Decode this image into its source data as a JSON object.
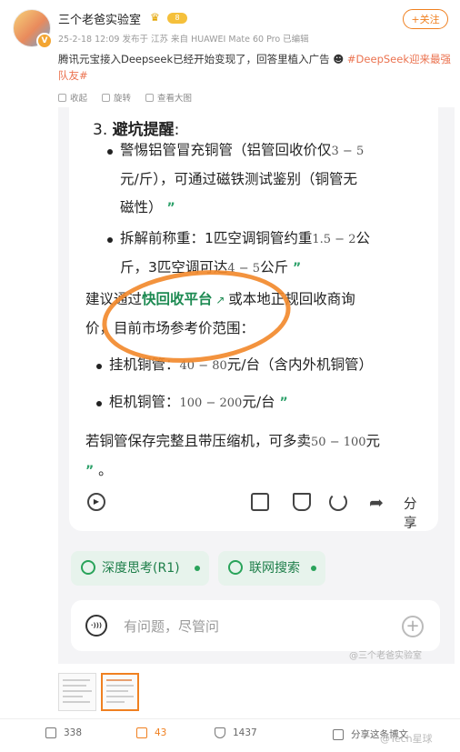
{
  "author": {
    "name": "三个老爸实验室",
    "vip_badge": "8"
  },
  "follow_label": "+关注",
  "meta": {
    "date": "25-2-18 12:09",
    "source": "发布于 江苏 来自 HUAWEI Mate 60 Pro 已编辑"
  },
  "post": {
    "text": "腾讯元宝接入Deepseek已经开始变现了，回答里植入广告",
    "hashtag": "#DeepSeek迎来最强队友#"
  },
  "toolbar": {
    "collapse": "收起",
    "rotate": "旋转",
    "view_large": "查看大图"
  },
  "answer": {
    "heading_num": "3.",
    "heading": "避坑提醒",
    "heading_colon": ":",
    "bullet1_line1a": "警惕铝管冒充铜管（铝管回收价仅",
    "bullet1_range": "3 − 5",
    "bullet1_line2": "元/斤），可通过磁铁测试鉴别（铜管无",
    "bullet1_line3": "磁性）",
    "bullet2_line1a": "拆解前称重：1匹空调铜管约重",
    "bullet2_range1": "1.5 − 2",
    "bullet2_unit": "公",
    "bullet2_line2a": "斤，3匹空调可达",
    "bullet2_range2": "4 − 5",
    "bullet2_line2b": "公斤",
    "para_line1a": "建议通过",
    "para_link": "快回收平台",
    "para_line1b": "或本地正规回收商询",
    "para_line2": "价，目前市场参考价范围：",
    "item1_label": "挂机铜管：",
    "item1_range": "40 − 80",
    "item1_unit": "元/台（含内外机铜管）",
    "item2_label": "柜机铜管：",
    "item2_range": "100 − 200",
    "item2_unit": "元/台",
    "final_line1a": "若铜管保存完整且带压缩机，可多卖",
    "final_range": "50 − 100",
    "final_unit": "元",
    "final_end": "。",
    "quote_mark": "”",
    "share_label": "分享"
  },
  "chips": {
    "deep_think": "深度思考(R1)",
    "web_search": "联网搜索"
  },
  "input": {
    "placeholder": "有问题，尽管问",
    "voice_icon": "·)))"
  },
  "watermark_inner": "@三个老爸实验室",
  "stats": {
    "reposts": "338",
    "comments": "43",
    "likes": "1437",
    "share": "分享这条博文"
  },
  "watermark_bottom": "@Tech星球",
  "colors": {
    "accent_orange": "#f08020",
    "green": "#1d8a52",
    "chip_bg": "#e7f3ec"
  },
  "icons": [
    "avatar",
    "crown-icon",
    "collapse-icon",
    "rotate-icon",
    "zoom-icon",
    "play-icon",
    "copy-icon",
    "dislike-icon",
    "refresh-icon",
    "share-icon",
    "deep-think-icon",
    "globe-icon",
    "voice-icon",
    "plus-icon",
    "repost-icon",
    "comment-icon",
    "like-icon"
  ]
}
